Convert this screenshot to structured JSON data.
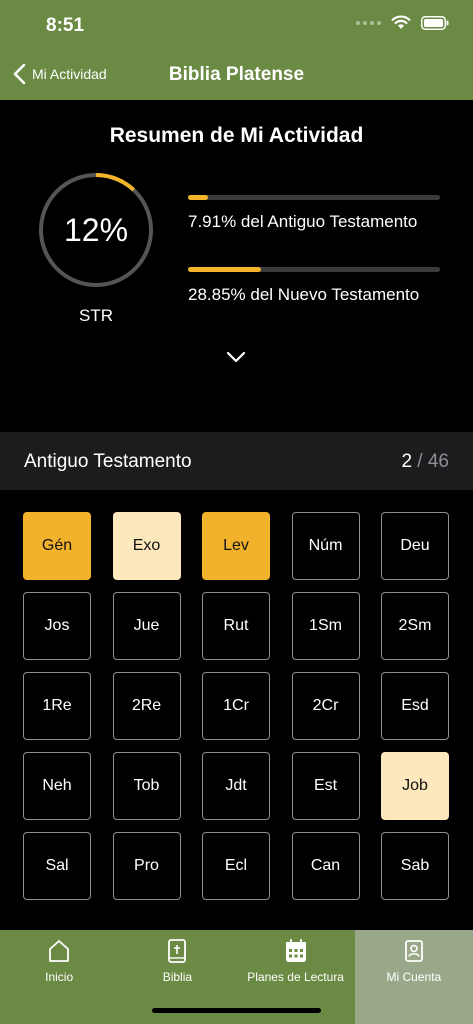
{
  "status": {
    "time": "8:51"
  },
  "nav": {
    "back_label": "Mi Actividad",
    "title": "Biblia Platense"
  },
  "summary": {
    "title": "Resumen de Mi Actividad",
    "overall_percent_text": "12%",
    "overall_fraction": 0.12,
    "overall_label": "STR",
    "old_testament": {
      "label": "7.91% del Antiguo Testamento",
      "fraction": 0.0791
    },
    "new_testament": {
      "label": "28.85% del Nuevo Testamento",
      "fraction": 0.2885
    }
  },
  "section": {
    "title": "Antiguo Testamento",
    "current": "2",
    "separator": " / ",
    "total": "46"
  },
  "colors": {
    "green": "#6b8a43",
    "accent": "#f2b22b",
    "partial": "#fde8bd",
    "active_tab": "#9aa88a"
  },
  "books": [
    {
      "abbr": "Gén",
      "state": "full"
    },
    {
      "abbr": "Exo",
      "state": "partial"
    },
    {
      "abbr": "Lev",
      "state": "full"
    },
    {
      "abbr": "Núm",
      "state": "none"
    },
    {
      "abbr": "Deu",
      "state": "none"
    },
    {
      "abbr": "Jos",
      "state": "none"
    },
    {
      "abbr": "Jue",
      "state": "none"
    },
    {
      "abbr": "Rut",
      "state": "none"
    },
    {
      "abbr": "1Sm",
      "state": "none"
    },
    {
      "abbr": "2Sm",
      "state": "none"
    },
    {
      "abbr": "1Re",
      "state": "none"
    },
    {
      "abbr": "2Re",
      "state": "none"
    },
    {
      "abbr": "1Cr",
      "state": "none"
    },
    {
      "abbr": "2Cr",
      "state": "none"
    },
    {
      "abbr": "Esd",
      "state": "none"
    },
    {
      "abbr": "Neh",
      "state": "none"
    },
    {
      "abbr": "Tob",
      "state": "none"
    },
    {
      "abbr": "Jdt",
      "state": "none"
    },
    {
      "abbr": "Est",
      "state": "none"
    },
    {
      "abbr": "Job",
      "state": "partial"
    },
    {
      "abbr": "Sal",
      "state": "none"
    },
    {
      "abbr": "Pro",
      "state": "none"
    },
    {
      "abbr": "Ecl",
      "state": "none"
    },
    {
      "abbr": "Can",
      "state": "none"
    },
    {
      "abbr": "Sab",
      "state": "none"
    }
  ],
  "tabs": [
    {
      "label": "Inicio",
      "icon": "home-icon",
      "active": false
    },
    {
      "label": "Biblia",
      "icon": "bible-icon",
      "active": false
    },
    {
      "label": "Planes de Lectura",
      "icon": "calendar-icon",
      "active": false
    },
    {
      "label": "Mi Cuenta",
      "icon": "account-icon",
      "active": true
    }
  ]
}
